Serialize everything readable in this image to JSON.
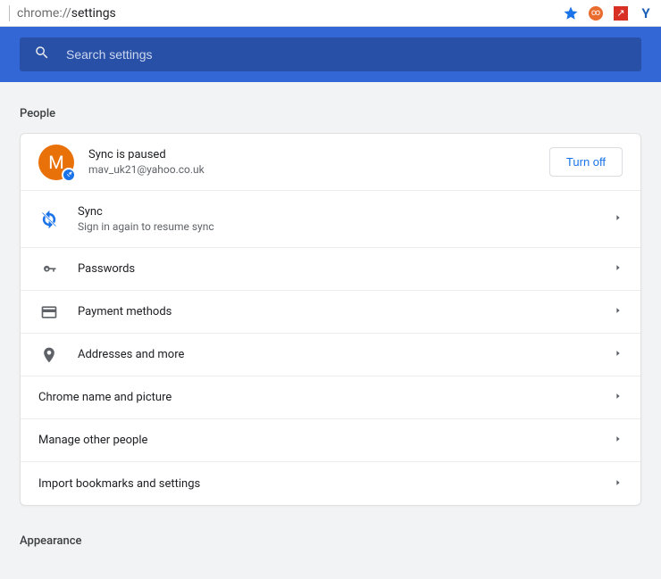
{
  "omnibox": {
    "prefix": "chrome://",
    "path": "settings"
  },
  "header": {
    "search_placeholder": "Search settings"
  },
  "sections": {
    "people_title": "People",
    "appearance_title": "Appearance"
  },
  "profile": {
    "avatar_letter": "M",
    "status": "Sync is paused",
    "email": "mav_uk21@yahoo.co.uk",
    "turn_off_label": "Turn off"
  },
  "rows": {
    "sync": {
      "title": "Sync",
      "subtitle": "Sign in again to resume sync"
    },
    "passwords": "Passwords",
    "payment": "Payment methods",
    "addresses": "Addresses and more",
    "name_pic": "Chrome name and picture",
    "manage_people": "Manage other people",
    "import": "Import bookmarks and settings"
  }
}
